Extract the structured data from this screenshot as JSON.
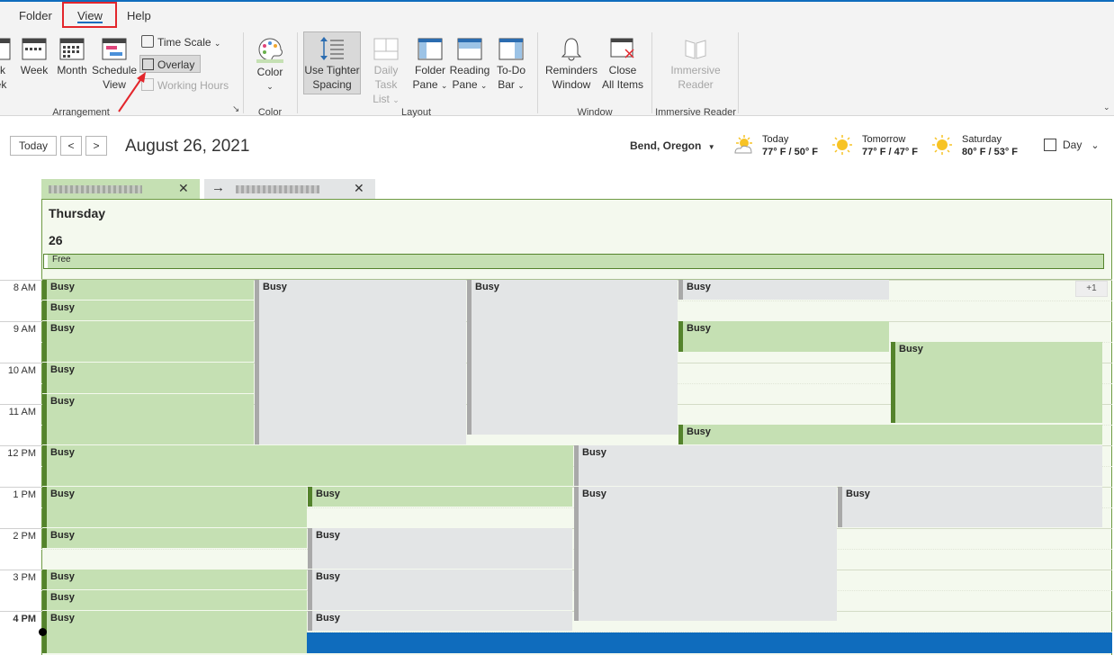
{
  "menu": {
    "folder": "Folder",
    "view": "View",
    "help": "Help"
  },
  "ribbon": {
    "arrangement": {
      "work_week": [
        "rk",
        "ek"
      ],
      "week": "Week",
      "month": "Month",
      "schedule_view": [
        "Schedule",
        "View"
      ],
      "time_scale": "Time Scale",
      "overlay": "Overlay",
      "working_hours": "Working Hours",
      "group_label": "Arrangement"
    },
    "color": {
      "label": "Color",
      "group_label": "Color"
    },
    "layout": {
      "tighter": [
        "Use Tighter",
        "Spacing"
      ],
      "daily_task": [
        "Daily Task",
        "List"
      ],
      "folder_pane": [
        "Folder",
        "Pane"
      ],
      "reading_pane": [
        "Reading",
        "Pane"
      ],
      "todo_bar": [
        "To-Do",
        "Bar"
      ],
      "group_label": "Layout"
    },
    "window": {
      "reminders": [
        "Reminders",
        "Window"
      ],
      "close_all": [
        "Close",
        "All Items"
      ],
      "group_label": "Window"
    },
    "immersive": {
      "reader": [
        "Immersive",
        "Reader"
      ],
      "group_label": "Immersive Reader"
    }
  },
  "nav": {
    "today": "Today",
    "prev": "<",
    "next": ">",
    "date": "August 26, 2021"
  },
  "location": "Bend, Oregon",
  "weather": [
    {
      "day": "Today",
      "temp": "77° F / 50° F"
    },
    {
      "day": "Tomorrow",
      "temp": "77° F / 47° F"
    },
    {
      "day": "Saturday",
      "temp": "80° F / 53° F"
    }
  ],
  "view_mode": "Day",
  "day": {
    "name": "Thursday",
    "number": "26",
    "allday": "Free",
    "more": "+1"
  },
  "hours": [
    "8 AM",
    "9 AM",
    "10 AM",
    "11 AM",
    "12 PM",
    "1 PM",
    "2 PM",
    "3 PM",
    "4 PM"
  ],
  "event_label": "Busy",
  "colors": {
    "accent": "#0f6cbd",
    "busy_green": "#c5e0b3",
    "busy_gray": "#e3e5e6",
    "highlight_red": "#e3262c"
  }
}
